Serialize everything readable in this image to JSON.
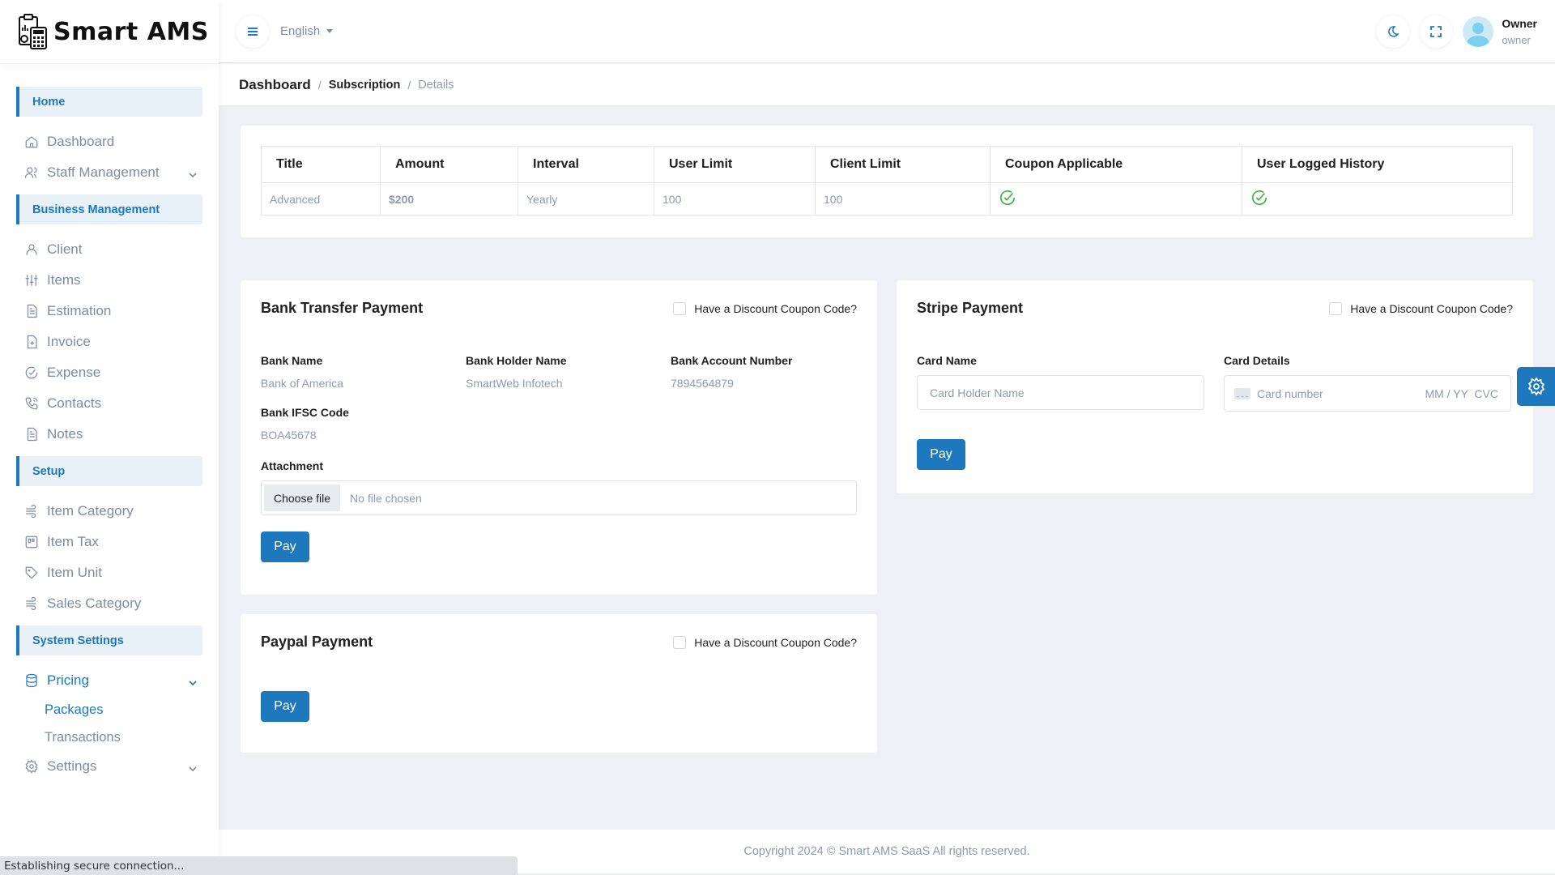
{
  "app": {
    "name": "Smart AMS"
  },
  "topbar": {
    "language": "English",
    "user": {
      "name": "Owner",
      "role": "owner"
    }
  },
  "breadcrumb": [
    "Dashboard",
    "Subscription",
    "Details"
  ],
  "sidebar": {
    "sections": {
      "home": "Home",
      "business": "Business Management",
      "setup": "Setup",
      "system": "System Settings"
    },
    "items": {
      "dashboard": "Dashboard",
      "staff": "Staff Management",
      "client": "Client",
      "items": "Items",
      "estimation": "Estimation",
      "invoice": "Invoice",
      "expense": "Expense",
      "contacts": "Contacts",
      "notes": "Notes",
      "item_category": "Item Category",
      "item_tax": "Item Tax",
      "item_unit": "Item Unit",
      "sales_category": "Sales Category",
      "pricing": "Pricing",
      "packages": "Packages",
      "transactions": "Transactions",
      "settings": "Settings"
    }
  },
  "plan_table": {
    "headers": [
      "Title",
      "Amount",
      "Interval",
      "User Limit",
      "Client Limit",
      "Coupon Applicable",
      "User Logged History"
    ],
    "row": {
      "title": "Advanced",
      "amount": "$200",
      "interval": "Yearly",
      "user_limit": "100",
      "client_limit": "100",
      "coupon_applicable": true,
      "user_logged_history": true
    }
  },
  "bank_transfer": {
    "title": "Bank Transfer Payment",
    "coupon_label": "Have a Discount Coupon Code?",
    "coupon_checked": false,
    "fields": {
      "bank_name_label": "Bank Name",
      "bank_name": "Bank of America",
      "holder_label": "Bank Holder Name",
      "holder": "SmartWeb Infotech",
      "account_label": "Bank Account Number",
      "account": "7894564879",
      "ifsc_label": "Bank IFSC Code",
      "ifsc": "BOA45678"
    },
    "attachment_label": "Attachment",
    "file_button": "Choose file",
    "file_status": "No file chosen",
    "pay_label": "Pay"
  },
  "paypal": {
    "title": "Paypal Payment",
    "coupon_label": "Have a Discount Coupon Code?",
    "coupon_checked": false,
    "pay_label": "Pay"
  },
  "stripe": {
    "title": "Stripe Payment",
    "coupon_label": "Have a Discount Coupon Code?",
    "coupon_checked": false,
    "card_name_label": "Card Name",
    "card_name_placeholder": "Card Holder Name",
    "card_details_label": "Card Details",
    "card_number_placeholder": "Card number",
    "expiry_cvc_placeholder": "MM / YY  CVC",
    "pay_label": "Pay"
  },
  "footer": {
    "text": "Copyright 2024 © Smart AMS SaaS All rights reserved."
  },
  "browser_status": "Establishing secure connection...",
  "colors": {
    "primary": "#1e78bd",
    "success": "#3fae49",
    "muted": "#8e9aaf"
  }
}
